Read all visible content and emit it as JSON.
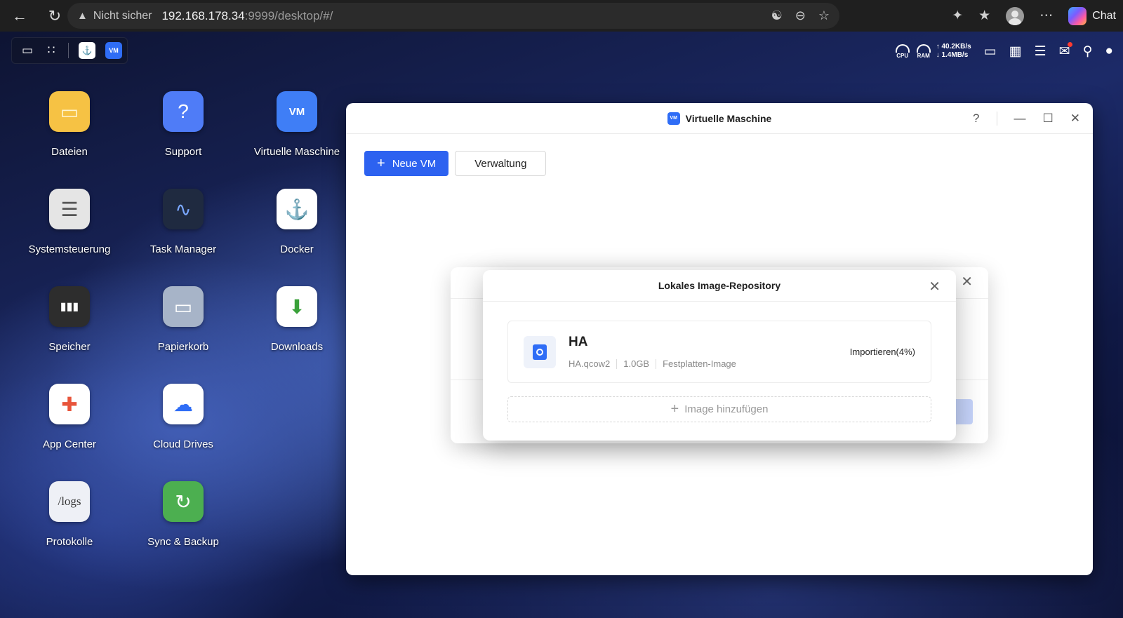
{
  "browser": {
    "insecure_label": "Nicht sicher",
    "url_host": "192.168.178.34",
    "url_path": ":9999/desktop/#/",
    "chat_label": "Chat"
  },
  "tray": {
    "cpu_label": "CPU",
    "ram_label": "RAM",
    "upload": "40.2KB/s",
    "download": "1.4MB/s"
  },
  "desktop_icons": [
    {
      "label": "Dateien",
      "icon": "folder-icon",
      "color": "#f6c244"
    },
    {
      "label": "Support",
      "icon": "question-icon",
      "color": "#4f7cf7"
    },
    {
      "label": "Virtuelle Maschine",
      "icon": "vm-icon",
      "color": "#3f7ef6"
    },
    {
      "label": "Systemsteuerung",
      "icon": "sliders-icon",
      "color": "#e5e5e5"
    },
    {
      "label": "Task Manager",
      "icon": "chart-icon",
      "color": "#1f2a40"
    },
    {
      "label": "Docker",
      "icon": "docker-icon",
      "color": "#ffffff"
    },
    {
      "label": "Speicher",
      "icon": "storage-icon",
      "color": "#2d2d2d"
    },
    {
      "label": "Papierkorb",
      "icon": "trash-icon",
      "color": "#a7b4c8"
    },
    {
      "label": "Downloads",
      "icon": "download-icon",
      "color": "#ffffff"
    },
    {
      "label": "App Center",
      "icon": "app-center-icon",
      "color": "#ffffff"
    },
    {
      "label": "Cloud Drives",
      "icon": "cloud-drive-icon",
      "color": "#ffffff"
    },
    {
      "label": "Protokolle",
      "icon": "logs-icon",
      "color": "#eef0f6",
      "glyph": "/logs"
    },
    {
      "label": "Sync & Backup",
      "icon": "sync-icon",
      "color": "#4caf50"
    }
  ],
  "vm_window": {
    "title": "Virtuelle Maschine",
    "title_icon_text": "VM",
    "new_vm_label": "Neue VM",
    "manage_label": "Verwaltung"
  },
  "repo_dialog": {
    "title": "Lokales Image-Repository",
    "image": {
      "name": "HA",
      "file": "HA.qcow2",
      "size": "1.0GB",
      "type": "Festplatten-Image",
      "status": "Importieren(4%)"
    },
    "add_label": "Image hinzufügen"
  },
  "colors": {
    "primary": "#2d62f0",
    "window_bg": "#ffffff"
  }
}
